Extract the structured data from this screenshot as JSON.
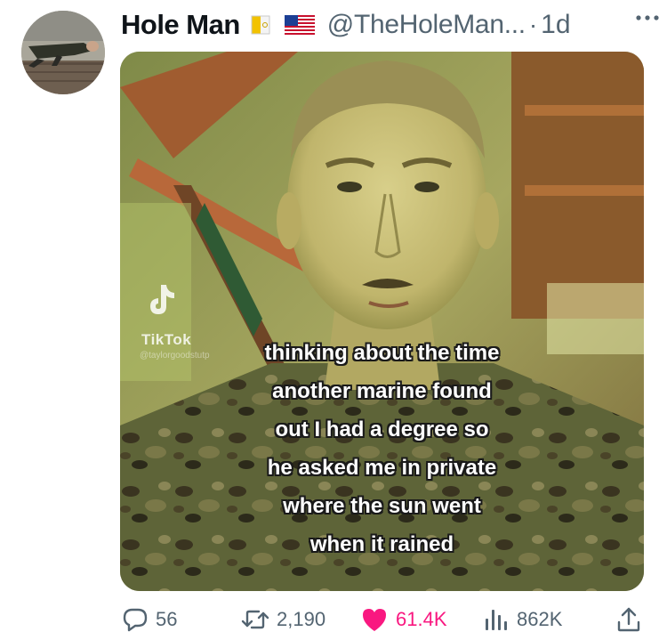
{
  "author": {
    "display_name": "Hole Man",
    "handle": "@TheHoleMan...",
    "separator": "·",
    "time": "1d",
    "badges": [
      "vatican-flag-icon",
      "us-flag-icon"
    ]
  },
  "media": {
    "watermark": {
      "brand": "TikTok",
      "username": "@taylorgoodstutp"
    },
    "caption_lines": [
      "thinking about the time",
      "another marine found",
      "out I had a degree so",
      "he asked me in private",
      "where the sun went",
      "when it rained"
    ]
  },
  "actions": {
    "replies": "56",
    "retweets": "2,190",
    "likes": "61.4K",
    "views": "862K"
  },
  "colors": {
    "secondary_text": "#536471",
    "like": "#f91880",
    "primary_text": "#0f1419"
  }
}
